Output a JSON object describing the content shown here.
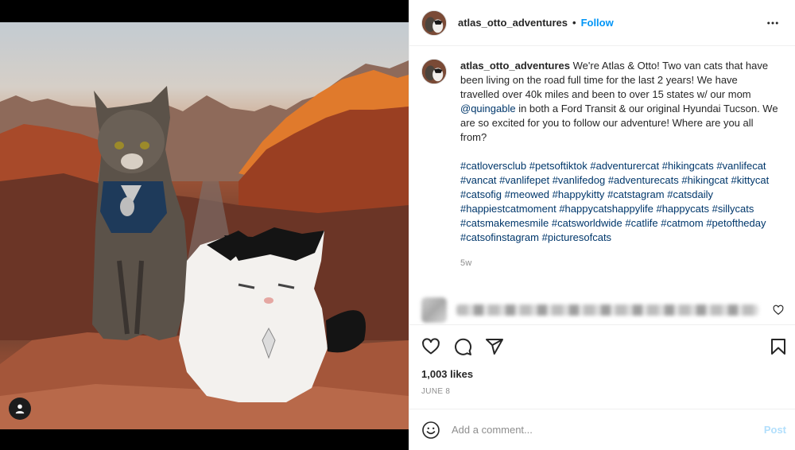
{
  "post": {
    "username": "atlas_otto_adventures",
    "follow_label": "Follow",
    "separator": "•"
  },
  "caption": {
    "username": "atlas_otto_adventures",
    "text_before_mention": " We're Atlas & Otto! Two van cats that have been living on the road full time for the last 2 years! We have travelled over 40k miles and been to over 15 states w/ our mom ",
    "mention": "@quingable",
    "text_after_mention": " in both a Ford Transit & our original Hyundai Tucson. We are so excited for you to follow our adventure! Where are you all from?",
    "hashtags": [
      "#catloversclub",
      "#petsoftiktok",
      "#adventurercat",
      "#hikingcats",
      "#vanlifecat",
      "#vancat",
      "#vanlifepet",
      "#vanlifedog",
      "#adventurecats",
      "#hikingcat",
      "#kittycat",
      "#catsofig",
      "#meowed",
      "#happykitty",
      "#catstagram",
      "#catsdaily",
      "#happiestcatmoment",
      "#happycatshappylife",
      "#happycats",
      "#sillycats",
      "#catsmakemesmile",
      "#catsworldwide",
      "#catlife",
      "#catmom",
      "#petoftheday",
      "#catsofinstagram",
      "#picturesofcats"
    ],
    "time_ago": "5w"
  },
  "engagement": {
    "likes": "1,003 likes",
    "date": "JUNE 8"
  },
  "comment_box": {
    "placeholder": "Add a comment...",
    "post_label": "Post"
  },
  "icons": {
    "more": "more-horizontal-icon",
    "like": "heart-icon",
    "comment": "comment-icon",
    "share": "share-icon",
    "save": "bookmark-icon",
    "emoji": "emoji-icon",
    "user_tag": "user-tag-icon"
  },
  "colors": {
    "accent_blue": "#0095f6",
    "link_blue": "#00376b",
    "post_disabled": "#b2dffc",
    "muted": "#8e8e8e"
  }
}
